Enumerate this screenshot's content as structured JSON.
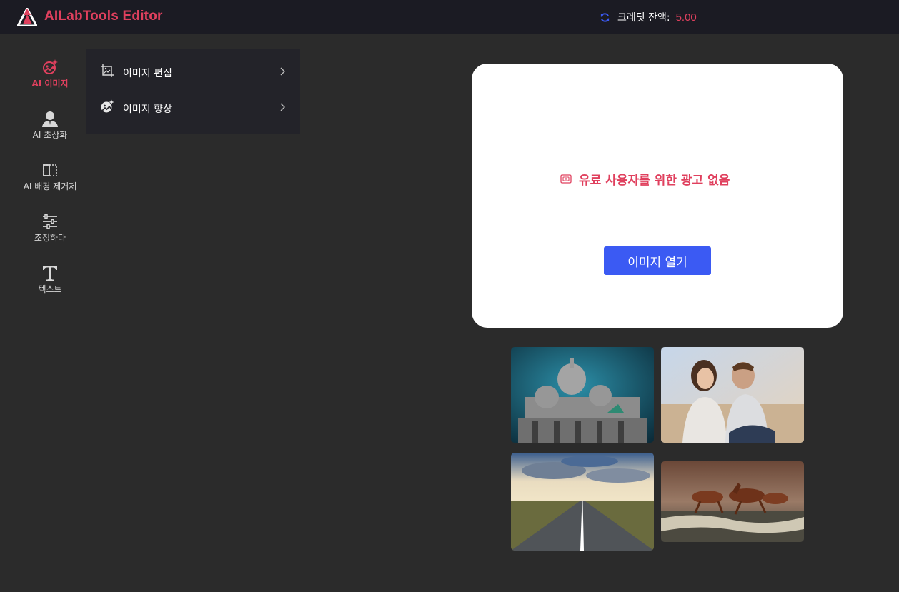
{
  "header": {
    "app_title": "AILabTools Editor",
    "credit_label": "크레딧 잔액:",
    "credit_value": "5.00"
  },
  "toolbar": {
    "items": [
      {
        "label": "AI 이미지",
        "icon": "ai-image-icon",
        "active": true
      },
      {
        "label": "AI 초상화",
        "icon": "portrait-icon",
        "active": false
      },
      {
        "label": "AI 배경 제거제",
        "icon": "background-remove-icon",
        "active": false
      },
      {
        "label": "조정하다",
        "icon": "sliders-icon",
        "active": false
      },
      {
        "label": "텍스트",
        "icon": "text-icon",
        "active": false
      }
    ]
  },
  "submenu": {
    "items": [
      {
        "label": "이미지 편집",
        "icon": "crop-image-icon"
      },
      {
        "label": "이미지 향상",
        "icon": "enhance-image-icon"
      }
    ]
  },
  "main": {
    "no_ads_text": "유료 사용자를 위한 광고 없음",
    "open_button": "이미지 열기"
  },
  "samples": [
    {
      "icon": "cathedral-sample-image"
    },
    {
      "icon": "couple-sample-image"
    },
    {
      "icon": "road-sample-image"
    },
    {
      "icon": "horses-sample-image"
    }
  ],
  "colors": {
    "accent": "#e0405e",
    "primary_button": "#3b5af3",
    "background": "#2b2b2b",
    "header": "#1b1b23"
  }
}
